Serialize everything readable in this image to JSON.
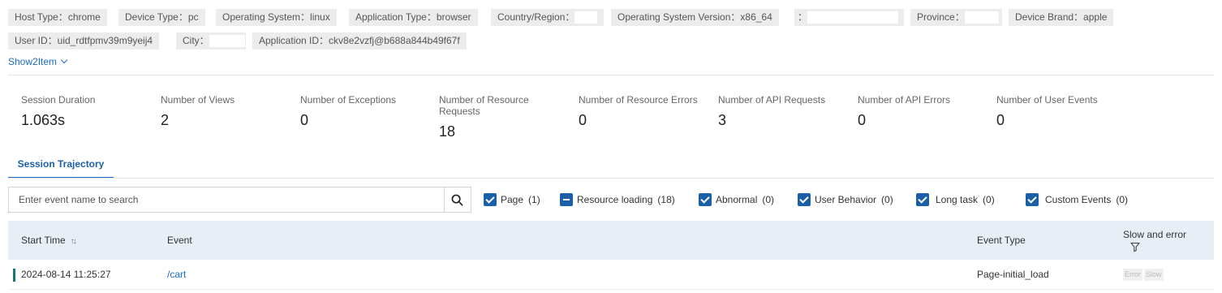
{
  "tags": [
    {
      "label": "Host Type：",
      "value": "chrome"
    },
    {
      "label": "Device Type：",
      "value": "pc"
    },
    {
      "label": "Operating System：",
      "value": "linux"
    },
    {
      "label": "Application Type：",
      "value": "browser"
    },
    {
      "label": "Country/Region：",
      "value": ""
    },
    {
      "label": "Operating System Version：",
      "value": "x86_64"
    },
    {
      "label": "：",
      "value": ""
    },
    {
      "label": "Province：",
      "value": ""
    },
    {
      "label": "Device Brand：",
      "value": "apple"
    },
    {
      "label": "User ID：",
      "value": "uid_rdtfpmv39m9yeij4"
    },
    {
      "label": "City：",
      "value": ""
    },
    {
      "label": "Application ID：",
      "value": "ckv8e2vzfj@b688a844b49f67f"
    }
  ],
  "show_more": "Show2Item",
  "stats": [
    {
      "label": "Session Duration",
      "value": "1.063s"
    },
    {
      "label": "Number of Views",
      "value": "2"
    },
    {
      "label": "Number of Exceptions",
      "value": "0"
    },
    {
      "label": "Number of Resource Requests",
      "value": "18"
    },
    {
      "label": "Number of Resource Errors",
      "value": "0"
    },
    {
      "label": "Number of API Requests",
      "value": "3"
    },
    {
      "label": "Number of API Errors",
      "value": "0"
    },
    {
      "label": "Number of User Events",
      "value": "0"
    }
  ],
  "tab": "Session Trajectory",
  "search": {
    "placeholder": "Enter event name to search"
  },
  "filters": [
    {
      "label": "Page",
      "count": "(1)",
      "state": "checked"
    },
    {
      "label": "Resource loading",
      "count": "(18)",
      "state": "indeterminate"
    },
    {
      "label": "Abnormal",
      "count": "(0)",
      "state": "checked"
    },
    {
      "label": "User Behavior",
      "count": "(0)",
      "state": "checked"
    },
    {
      "label": "Long task",
      "count": "(0)",
      "state": "checked"
    },
    {
      "label": "Custom Events",
      "count": "(0)",
      "state": "checked"
    }
  ],
  "table": {
    "headers": {
      "start_time": "Start Time",
      "event": "Event",
      "event_type": "Event Type",
      "slow_error": "Slow and error"
    },
    "rows": [
      {
        "start_time": "2024-08-14 11:25:27",
        "event": "/cart",
        "event_type": "Page-initial_load",
        "error_badge": "Error",
        "slow_badge": "Slow"
      }
    ]
  },
  "colors": {
    "accent": "#1b6bc8",
    "checkbox": "#1b5fa8",
    "row_marker": "#19786f",
    "header_bg": "#e8eef6",
    "tag_bg": "#ececec"
  }
}
